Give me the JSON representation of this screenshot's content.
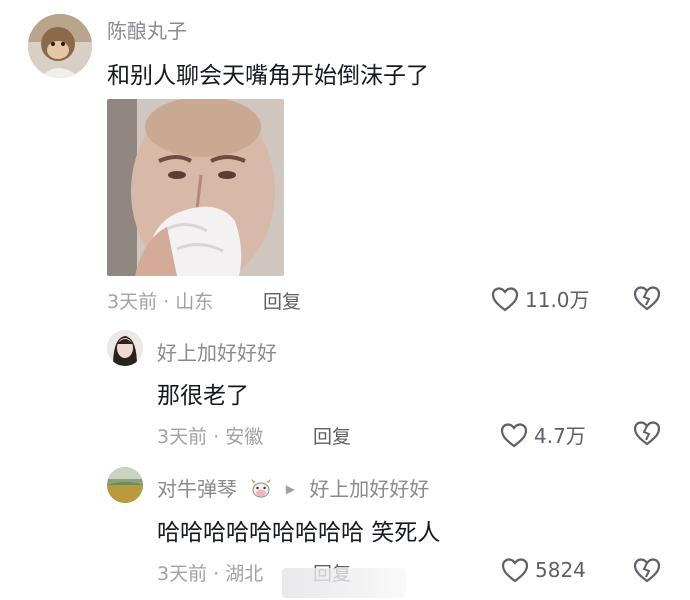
{
  "comments": [
    {
      "username": "陈酿丸子",
      "text": "和别人聊会天嘴角开始倒沫子了",
      "meta": "3天前 · 山东",
      "reply_label": "回复",
      "likes": "11.0万",
      "avatar_icon": "monkey-avatar",
      "sticker_icon": "crying-man-sticker"
    },
    {
      "username": "好上加好好好",
      "text": "那很老了",
      "meta": "3天前 · 安徽",
      "reply_label": "回复",
      "likes": "4.7万",
      "avatar_icon": "woman-avatar"
    },
    {
      "username": "对牛弹琴",
      "reply_to": "好上加好好好",
      "badge_icon": "cow-icon",
      "text": "哈哈哈哈哈哈哈哈哈  笑死人",
      "meta": "3天前 · 湖北",
      "reply_label": "回复",
      "likes": "5824",
      "avatar_icon": "field-avatar"
    }
  ],
  "colors": {
    "text": "#161823",
    "secondary": "#8a8b91",
    "meta": "#a1a2a7"
  }
}
